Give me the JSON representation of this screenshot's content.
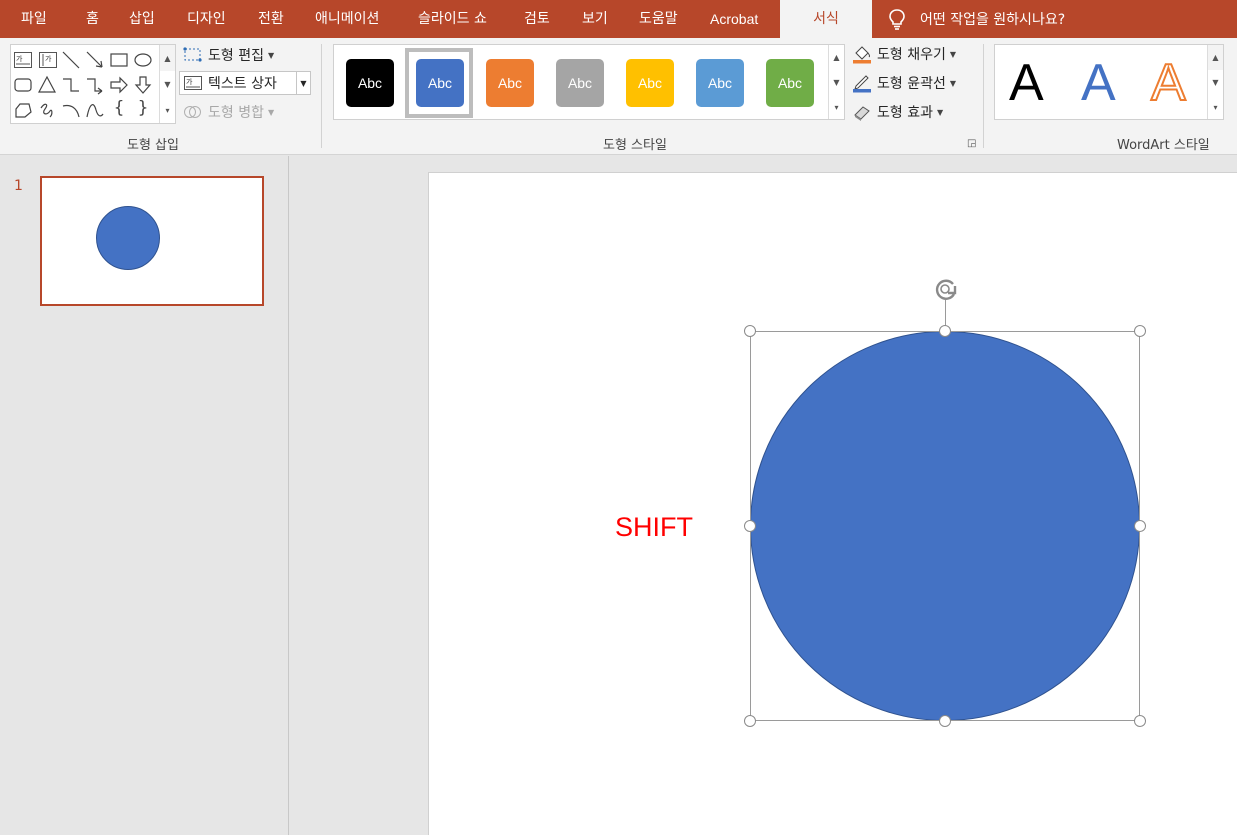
{
  "tabs": [
    {
      "label": "파일"
    },
    {
      "label": "홈"
    },
    {
      "label": "삽입"
    },
    {
      "label": "디자인"
    },
    {
      "label": "전환"
    },
    {
      "label": "애니메이션"
    },
    {
      "label": "슬라이드 쇼"
    },
    {
      "label": "검토"
    },
    {
      "label": "보기"
    },
    {
      "label": "도움말"
    },
    {
      "label": "Acrobat"
    },
    {
      "label": "서식",
      "active": true
    }
  ],
  "tell_me": "어떤 작업을 원하시나요?",
  "ribbon": {
    "insert_shapes": {
      "label": "도형 삽입",
      "edit_shape": "도형 편집",
      "text_box": "텍스트 상자",
      "merge_shapes": "도형 병합"
    },
    "shape_styles": {
      "label": "도형 스타일",
      "swatches": [
        {
          "text": "Abc",
          "color": "#000000"
        },
        {
          "text": "Abc",
          "color": "#4472c4",
          "selected": true
        },
        {
          "text": "Abc",
          "color": "#ed7d31"
        },
        {
          "text": "Abc",
          "color": "#a5a5a5"
        },
        {
          "text": "Abc",
          "color": "#ffc000"
        },
        {
          "text": "Abc",
          "color": "#5b9bd5"
        },
        {
          "text": "Abc",
          "color": "#70ad47"
        }
      ],
      "fill": "도형 채우기",
      "outline": "도형 윤곽선",
      "effects": "도형 효과"
    },
    "wordart": {
      "label": "WordArt 스타일",
      "samples": [
        {
          "text": "A"
        },
        {
          "text": "A"
        },
        {
          "text": "A"
        }
      ]
    }
  },
  "thumbnail": {
    "number": "1"
  },
  "slide": {
    "shift_label": "SHIFT",
    "shape_fill": "#4472c4",
    "shape_outline": "#2f528f"
  },
  "colors": {
    "accent": "#b7472a"
  }
}
